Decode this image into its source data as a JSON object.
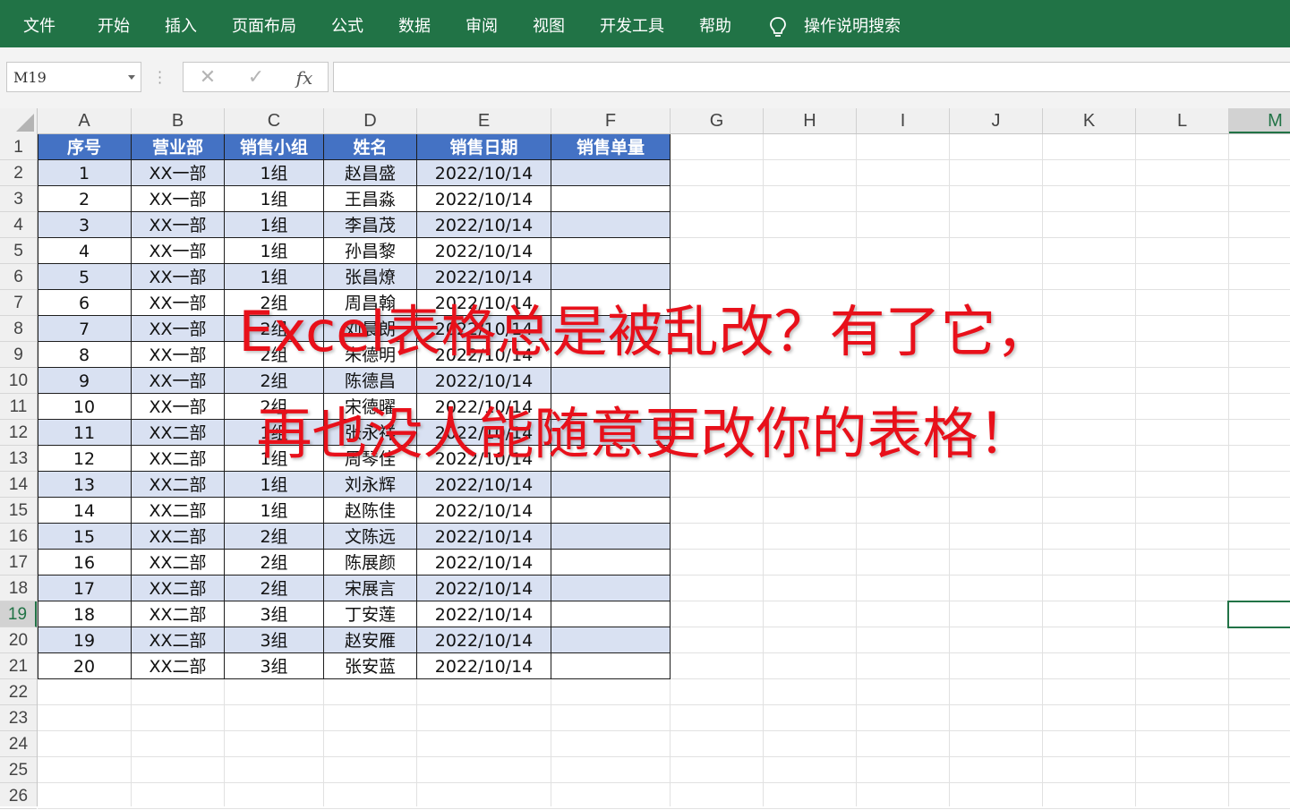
{
  "menu": {
    "items": [
      "文件",
      "开始",
      "插入",
      "页面布局",
      "公式",
      "数据",
      "审阅",
      "视图",
      "开发工具",
      "帮助"
    ],
    "search_label": "操作说明搜索",
    "bar_color": "#217346"
  },
  "formula_bar": {
    "name_box": "M19",
    "cancel_symbol": "✕",
    "confirm_symbol": "✓",
    "fx_label": "fx",
    "formula_value": ""
  },
  "sheet": {
    "columns": [
      "A",
      "B",
      "C",
      "D",
      "E",
      "F",
      "G",
      "H",
      "I",
      "J",
      "K",
      "L",
      "M"
    ],
    "selected_column": "M",
    "row_numbers": [
      "1",
      "2",
      "3",
      "4",
      "5",
      "6",
      "7",
      "8",
      "9",
      "10",
      "11",
      "12",
      "13",
      "14",
      "15",
      "16",
      "17",
      "18",
      "19",
      "20",
      "21",
      "22",
      "23",
      "24",
      "25",
      "26"
    ],
    "selected_row": "19",
    "selected_cell": "M19"
  },
  "table": {
    "headers": [
      "序号",
      "营业部",
      "销售小组",
      "姓名",
      "销售日期",
      "销售单量"
    ],
    "header_color": "#4472c4",
    "band_color": "#d9e1f2",
    "rows": [
      [
        "1",
        "XX一部",
        "1组",
        "赵昌盛",
        "2022/10/14",
        ""
      ],
      [
        "2",
        "XX一部",
        "1组",
        "王昌淼",
        "2022/10/14",
        ""
      ],
      [
        "3",
        "XX一部",
        "1组",
        "李昌茂",
        "2022/10/14",
        ""
      ],
      [
        "4",
        "XX一部",
        "1组",
        "孙昌黎",
        "2022/10/14",
        ""
      ],
      [
        "5",
        "XX一部",
        "1组",
        "张昌燎",
        "2022/10/14",
        ""
      ],
      [
        "6",
        "XX一部",
        "2组",
        "周昌翰",
        "2022/10/14",
        ""
      ],
      [
        "7",
        "XX一部",
        "2组",
        "刘晨朗",
        "2022/10/14",
        ""
      ],
      [
        "8",
        "XX一部",
        "2组",
        "朱德明",
        "2022/10/14",
        ""
      ],
      [
        "9",
        "XX一部",
        "2组",
        "陈德昌",
        "2022/10/14",
        ""
      ],
      [
        "10",
        "XX一部",
        "2组",
        "宋德曜",
        "2022/10/14",
        ""
      ],
      [
        "11",
        "XX二部",
        "1组",
        "张永祥",
        "2022/10/14",
        ""
      ],
      [
        "12",
        "XX二部",
        "1组",
        "周琴佳",
        "2022/10/14",
        ""
      ],
      [
        "13",
        "XX二部",
        "1组",
        "刘永辉",
        "2022/10/14",
        ""
      ],
      [
        "14",
        "XX二部",
        "1组",
        "赵陈佳",
        "2022/10/14",
        ""
      ],
      [
        "15",
        "XX二部",
        "2组",
        "文陈远",
        "2022/10/14",
        ""
      ],
      [
        "16",
        "XX二部",
        "2组",
        "陈展颜",
        "2022/10/14",
        ""
      ],
      [
        "17",
        "XX二部",
        "2组",
        "宋展言",
        "2022/10/14",
        ""
      ],
      [
        "18",
        "XX二部",
        "3组",
        "丁安莲",
        "2022/10/14",
        ""
      ],
      [
        "19",
        "XX二部",
        "3组",
        "赵安雁",
        "2022/10/14",
        ""
      ],
      [
        "20",
        "XX二部",
        "3组",
        "张安蓝",
        "2022/10/14",
        ""
      ]
    ]
  },
  "overlay": {
    "line1": "Excel表格总是被乱改？有了它，",
    "line2": "再也没人能随意更改你的表格！",
    "color": "#e8101a"
  }
}
